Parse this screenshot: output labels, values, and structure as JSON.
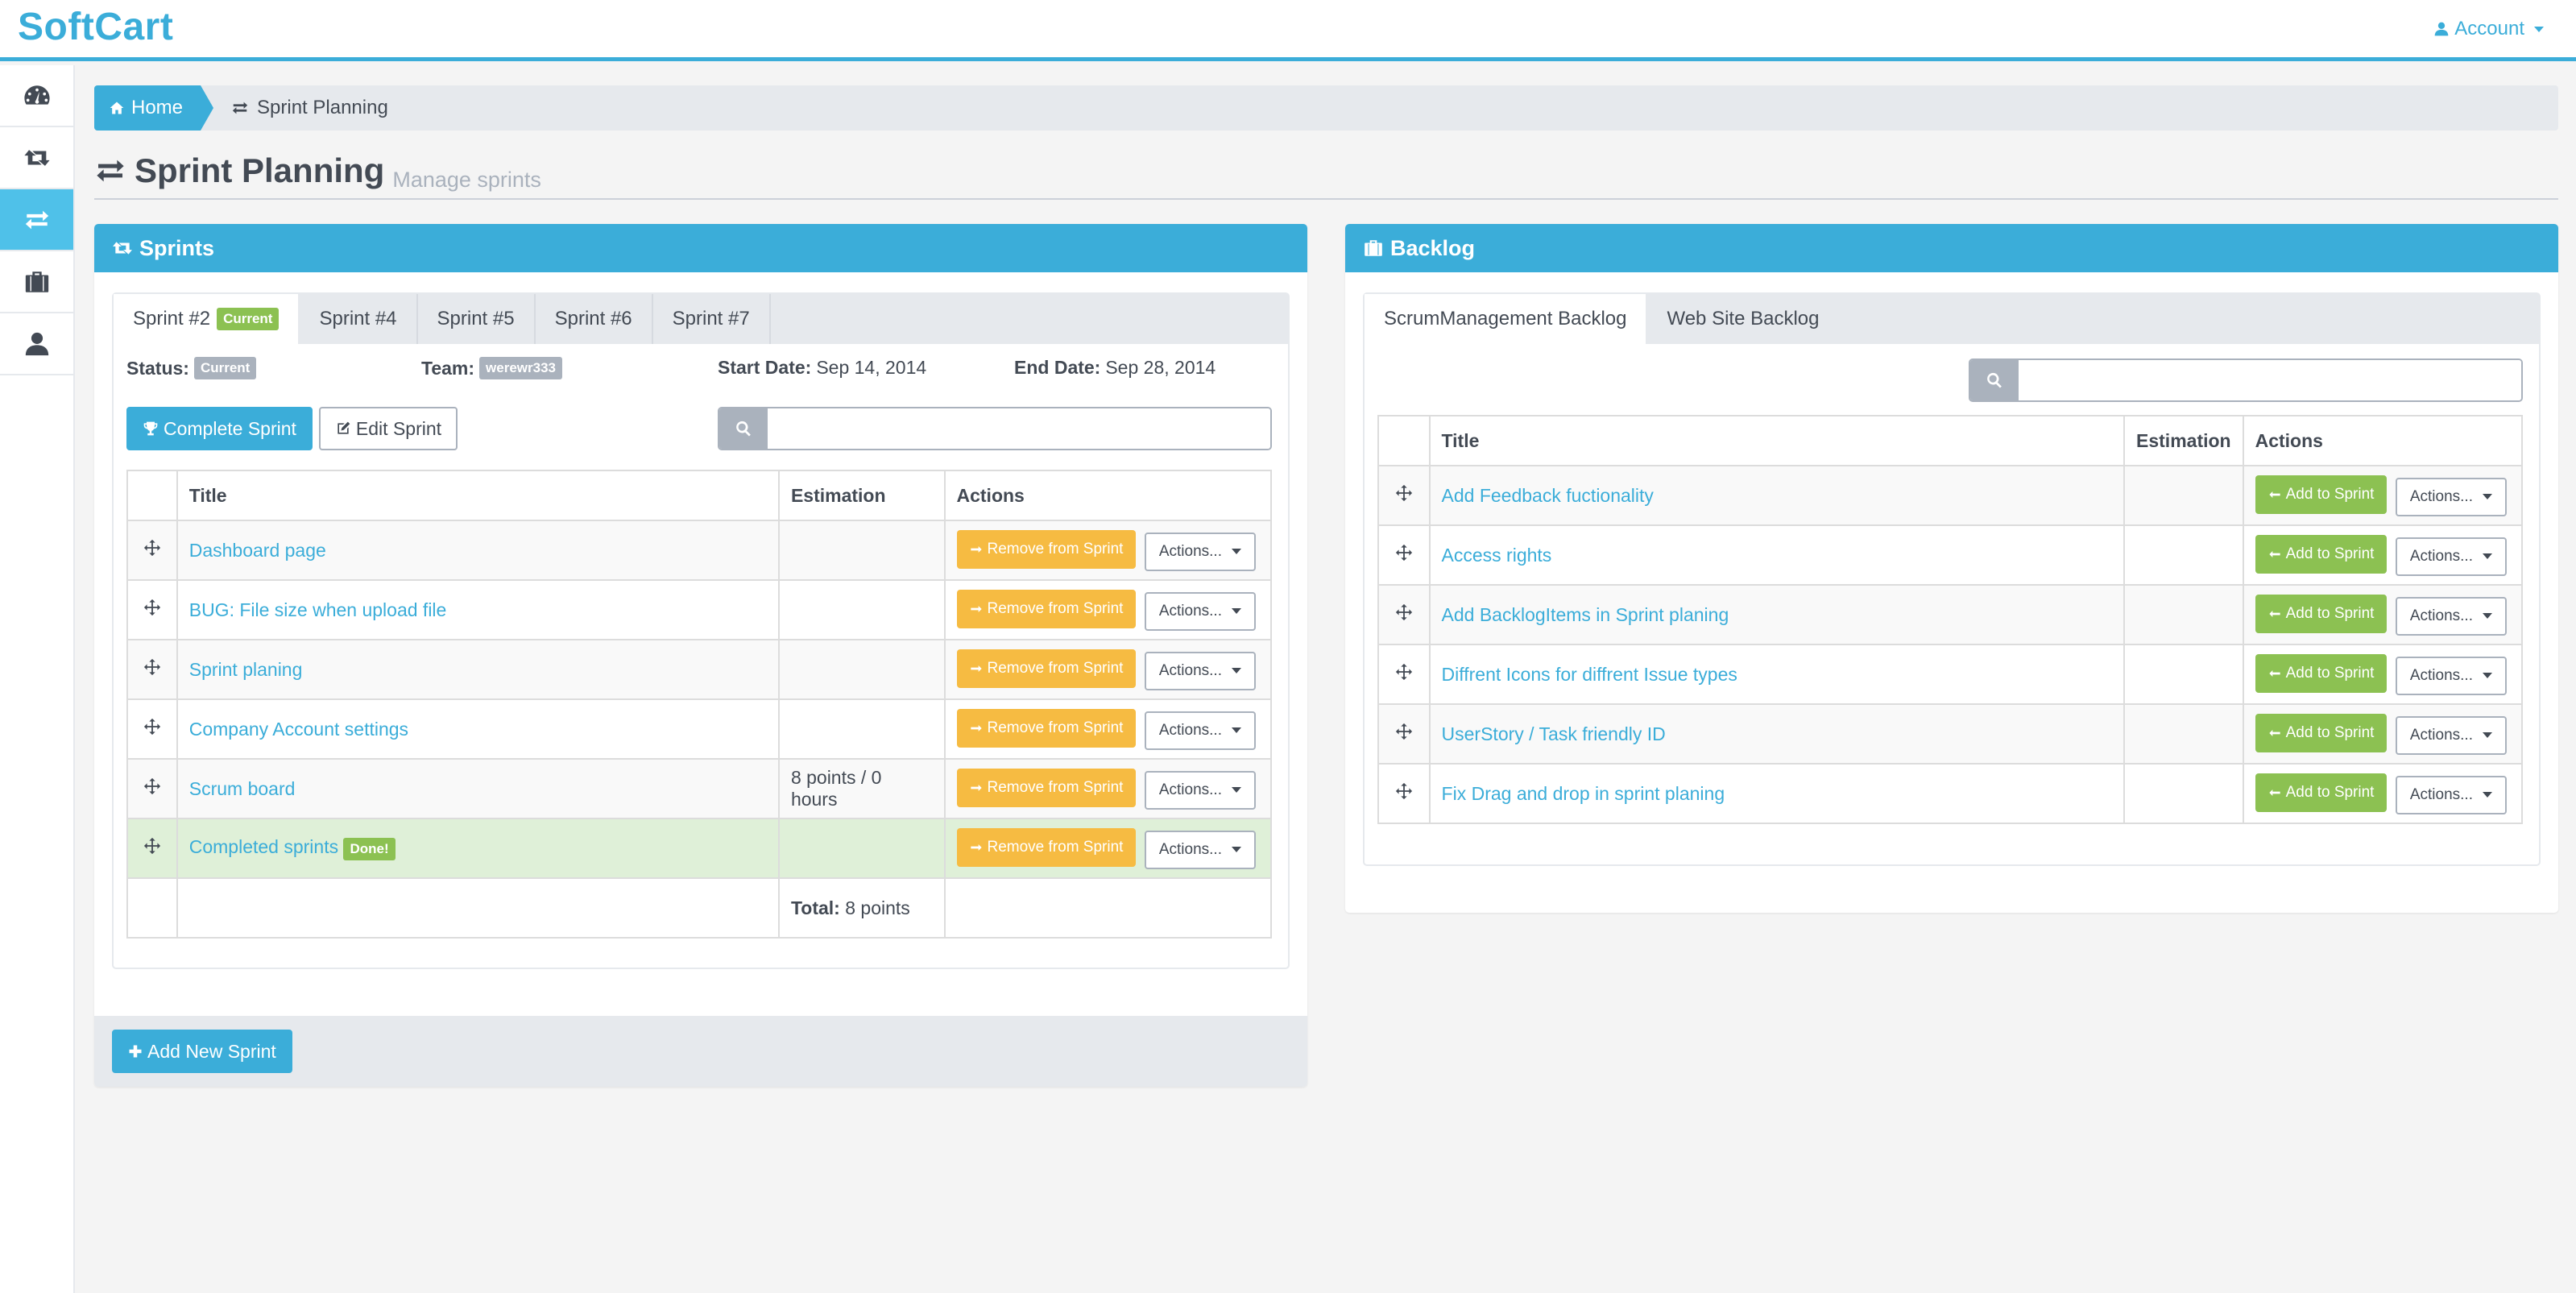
{
  "navbar": {
    "brand": "SoftCart",
    "account_label": "Account"
  },
  "sidebar": {
    "items": [
      {
        "icon": "dashboard-icon",
        "active": false
      },
      {
        "icon": "retweet-icon",
        "active": false
      },
      {
        "icon": "exchange-icon",
        "active": true
      },
      {
        "icon": "briefcase-icon",
        "active": false
      },
      {
        "icon": "user-icon",
        "active": false
      }
    ]
  },
  "breadcrumb": {
    "home": "Home",
    "current": "Sprint Planning"
  },
  "page_header": {
    "title": "Sprint Planning",
    "subtitle": "Manage sprints"
  },
  "sprints_panel": {
    "title": "Sprints",
    "tabs": [
      {
        "label": "Sprint #2",
        "badge": "Current",
        "active": true
      },
      {
        "label": "Sprint #4",
        "active": false
      },
      {
        "label": "Sprint #5",
        "active": false
      },
      {
        "label": "Sprint #6",
        "active": false
      },
      {
        "label": "Sprint #7",
        "active": false
      }
    ],
    "status_label": "Status:",
    "status_value": "Current",
    "team_label": "Team:",
    "team_value": "werewr333",
    "start_label": "Start Date:",
    "start_value": "Sep 14, 2014",
    "end_label": "End Date:",
    "end_value": "Sep 28, 2014",
    "complete_button": "Complete Sprint",
    "edit_button": "Edit Sprint",
    "search_value": "",
    "columns": [
      "",
      "Title",
      "Estimation",
      "Actions"
    ],
    "rows": [
      {
        "title": "Dashboard page",
        "estimation": "",
        "badge": ""
      },
      {
        "title": "BUG: File size when upload file",
        "estimation": "",
        "badge": ""
      },
      {
        "title": "Sprint planing",
        "estimation": "",
        "badge": ""
      },
      {
        "title": "Company Account settings",
        "estimation": "",
        "badge": ""
      },
      {
        "title": "Scrum board",
        "estimation": "8 points / 0 hours",
        "badge": ""
      },
      {
        "title": "Completed sprints",
        "estimation": "",
        "badge": "Done!"
      }
    ],
    "remove_button": "Remove from Sprint",
    "actions_button": "Actions...",
    "total_label": "Total:",
    "total_value": "8 points",
    "add_sprint_button": "Add New Sprint"
  },
  "backlog_panel": {
    "title": "Backlog",
    "tabs": [
      {
        "label": "ScrumManagement Backlog",
        "active": true
      },
      {
        "label": "Web Site Backlog",
        "active": false
      }
    ],
    "search_value": "",
    "columns": [
      "",
      "Title",
      "Estimation",
      "Actions"
    ],
    "rows": [
      {
        "title": "Add Feedback fuctionality",
        "estimation": ""
      },
      {
        "title": "Access rights",
        "estimation": ""
      },
      {
        "title": "Add BacklogItems in Sprint planing",
        "estimation": ""
      },
      {
        "title": "Diffrent Icons for diffrent Issue types",
        "estimation": ""
      },
      {
        "title": "UserStory / Task friendly ID",
        "estimation": ""
      },
      {
        "title": "Fix Drag and drop in sprint planing",
        "estimation": ""
      }
    ],
    "add_button": "Add to Sprint",
    "actions_button": "Actions..."
  },
  "colors": {
    "primary": "#3badd9",
    "warning": "#f6bb42",
    "success": "#8cc152",
    "muted": "#aab2bd",
    "text": "#434a54",
    "done_row": "#dff0d8"
  }
}
